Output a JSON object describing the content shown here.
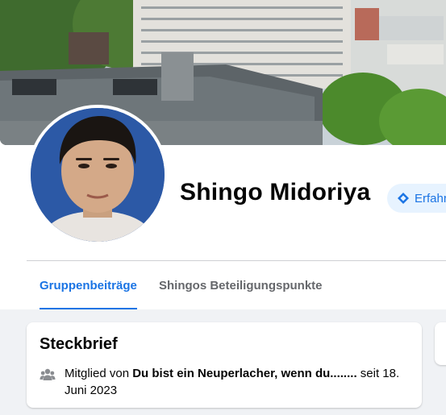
{
  "profile": {
    "name": "Shingo Midoriya",
    "badge_label": "Erfahr"
  },
  "tabs": [
    {
      "label": "Gruppenbeiträge",
      "active": true
    },
    {
      "label": "Shingos Beteiligungspunkte",
      "active": false
    }
  ],
  "intro": {
    "title": "Steckbrief",
    "member_prefix": "Mitglied von ",
    "group_name": "Du bist ein Neuperlacher, wenn du........",
    "member_suffix": " seit 18. Juni 2023"
  },
  "icons": {
    "badge": "diamond-badge-icon",
    "members": "group-members-icon"
  },
  "colors": {
    "accent": "#1b74e4",
    "badge_bg": "#e7f3ff",
    "page_bg": "#f0f2f5",
    "muted_text": "#65676b"
  }
}
